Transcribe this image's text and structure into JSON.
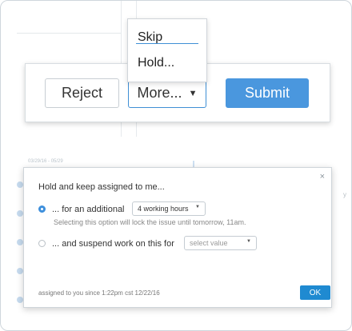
{
  "action_bar": {
    "reject_label": "Reject",
    "more_label": "More...",
    "more_caret": "▼",
    "submit_label": "Submit"
  },
  "more_menu": {
    "items": [
      {
        "label": "Skip"
      },
      {
        "label": "Hold..."
      }
    ]
  },
  "background": {
    "date_text": "03/29/16 - 05/29",
    "side_text": "y"
  },
  "hold_dialog": {
    "close": "×",
    "title": "Hold and keep assigned to me...",
    "option1": {
      "label": "... for an additional",
      "selected": true,
      "select_value": "4 working hours",
      "hint": "Selecting this option will lock the issue until tomorrow, 11am."
    },
    "option2": {
      "label": "... and suspend work on this for",
      "selected": false,
      "select_placeholder": "select value"
    },
    "footer": "assigned to you since 1:22pm cst 12/22/16",
    "ok_label": "OK",
    "select_arrow": "▼"
  },
  "colors": {
    "accent": "#4a97de",
    "ok_button": "#1f8ad1",
    "radio_selected": "#3d8fdc"
  }
}
